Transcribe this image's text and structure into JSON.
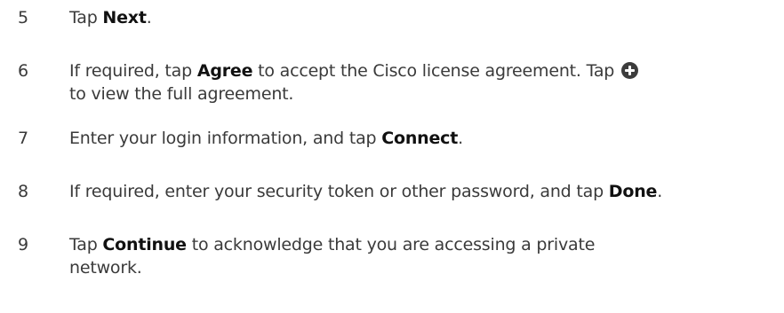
{
  "steps": [
    {
      "number": "5",
      "t1": "Tap ",
      "b1": "Next",
      "t2": "."
    },
    {
      "number": "6",
      "t1": "If required, tap ",
      "b1": "Agree",
      "t2": " to accept the Cisco license agreement. Tap ",
      "icon": "plus-circle-icon",
      "t3": " to view the full agreement."
    },
    {
      "number": "7",
      "t1": "Enter your login information, and tap ",
      "b1": "Connect",
      "t2": "."
    },
    {
      "number": "8",
      "t1": "If required, enter your security token or other password, and tap ",
      "b1": "Done",
      "t2": "."
    },
    {
      "number": "9",
      "t1": "Tap ",
      "b1": "Continue",
      "t2": " to acknowledge that you are accessing a private network."
    }
  ]
}
